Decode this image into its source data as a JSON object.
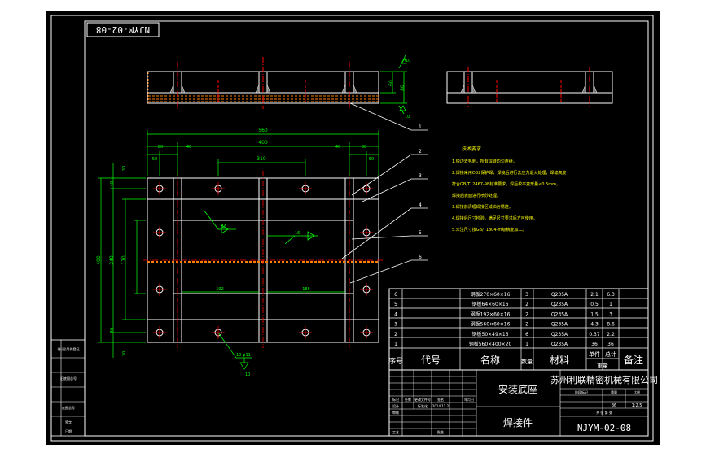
{
  "drawing_number_upside": "NJYM-02-08",
  "drawing_number": "NJYM-02-08",
  "part_title": "安装底座",
  "part_type": "焊接件",
  "company": "苏州利联精密机械有限公司",
  "tech_requirements_title": "技术要求",
  "tech_requirements": [
    "1.锐边去毛刺，所有焊缝均匀连续。",
    "2.焊接采用CO2保护焊，焊接后进行去应力退火处理，焊缝高度",
    "   符合GB/T12467-98标准要求，焊后校平变形量≤0.5mm，",
    "   焊接后表面进行喷砂处理。",
    "3.焊接前清理焊接区域油污锈迹。",
    "4.焊接后尺寸检验，满足尺寸要求后方可使用。",
    "5.未注尺寸按GB/T1804-m级精度加工。"
  ],
  "bom_rows": [
    {
      "no": "6",
      "name": "钢板270×60×16",
      "qty": "3",
      "mat": "Q235A",
      "w1": "2.1",
      "w2": "6.3"
    },
    {
      "no": "5",
      "name": "钢板64×60×16",
      "qty": "2",
      "mat": "Q235A",
      "w1": "0.5",
      "w2": "1"
    },
    {
      "no": "4",
      "name": "钢板192×60×16",
      "qty": "2",
      "mat": "Q235A",
      "w1": "1.5",
      "w2": "3"
    },
    {
      "no": "3",
      "name": "钢板560×60×16",
      "qty": "2",
      "mat": "Q235A",
      "w1": "4.3",
      "w2": "8.6"
    },
    {
      "no": "2",
      "name": "钢板50×49×16",
      "qty": "6",
      "mat": "Q235A",
      "w1": "0.37",
      "w2": "2.2"
    },
    {
      "no": "1",
      "name": "钢板560×400×20",
      "qty": "1",
      "mat": "Q235A",
      "w1": "36",
      "w2": "36"
    }
  ],
  "bom_header": {
    "no": "序号",
    "code": "代号",
    "name": "名称",
    "qty": "数量",
    "mat": "材料",
    "single": "单件",
    "total": "总计",
    "weight": "重量",
    "note": "备注"
  },
  "scale": "1:2.5",
  "title_cells": {
    "mark": "标记",
    "count": "处数",
    "zone": "分区",
    "change_doc": "更改文件号",
    "sign": "签名",
    "date_label": "年月日",
    "designer": "设计",
    "standard": "标准化",
    "review": "审核",
    "craft": "工艺",
    "approve": "批准",
    "stage": "阶段标记",
    "weight": "重量",
    "ratio": "比例",
    "sheets": "共 张 第 张",
    "date_value": "2014.11.2"
  },
  "side_cells": [
    "借(通)用件登记",
    "旧底图总号",
    "底图总号",
    "签字",
    "日期"
  ],
  "leader_numbers": [
    "1",
    "2",
    "3",
    "4",
    "5",
    "6"
  ],
  "dimensions": {
    "overall_width": "560",
    "inner_width": "400",
    "hole_span": "310",
    "left_offset": "80",
    "right_offset": "80",
    "edge_40": "40",
    "edge_50": "50",
    "overall_height": "400",
    "inner_height": "240",
    "mid_height": "170",
    "h_40": "40",
    "h_30": "30",
    "bottom_192": "192",
    "bottom_186": "186",
    "section_height": "60",
    "section_total": "80",
    "weld_size": "10",
    "hole_note": "10-φ11",
    "weld_note": "16"
  },
  "colors": {
    "line": "#ffffff",
    "frame": "#000000",
    "dimension": "#00ff00",
    "center": "#ff0000",
    "text_yellow": "#ffff00",
    "hatch": "#ff8000"
  }
}
